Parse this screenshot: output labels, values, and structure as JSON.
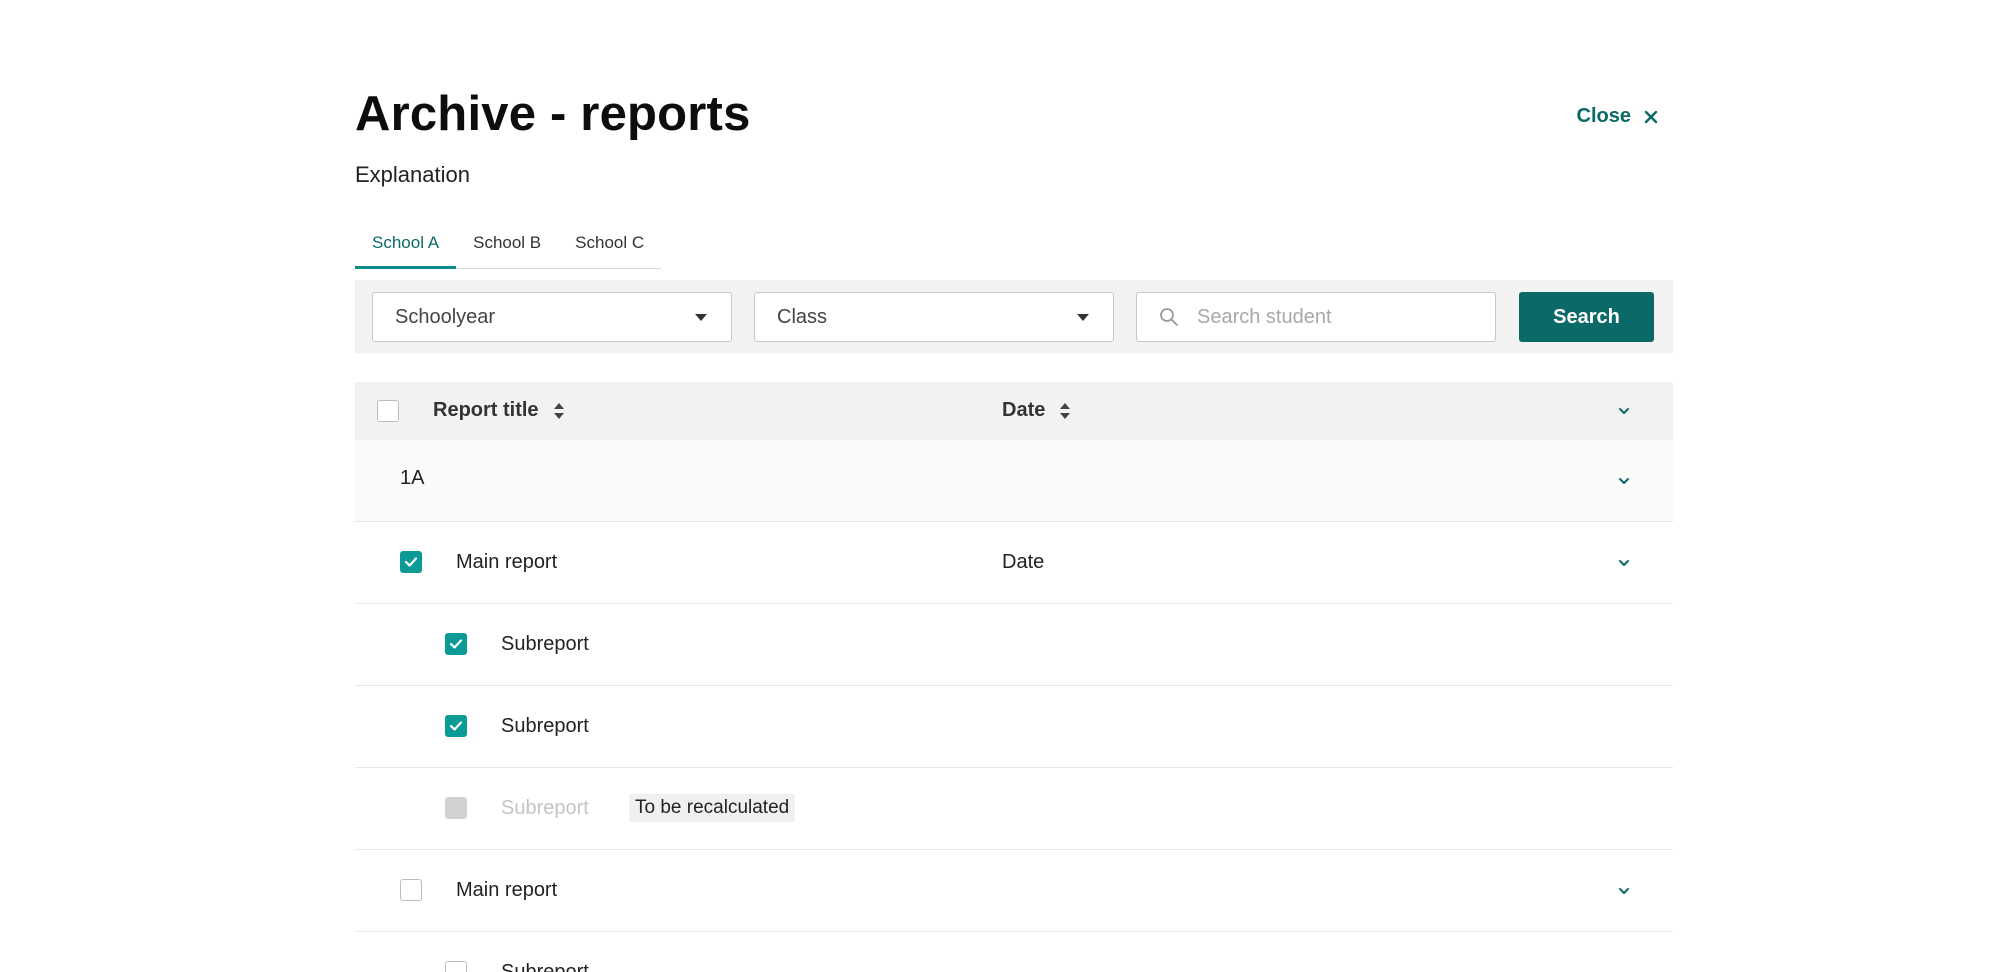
{
  "page": {
    "title": "Archive - reports",
    "subtitle": "Explanation",
    "close_label": "Close"
  },
  "tabs": [
    {
      "label": "School A",
      "active": true
    },
    {
      "label": "School B",
      "active": false
    },
    {
      "label": "School C",
      "active": false
    }
  ],
  "filters": {
    "schoolyear_label": "Schoolyear",
    "class_label": "Class",
    "search_placeholder": "Search student",
    "search_button": "Search"
  },
  "table": {
    "columns": {
      "title": "Report title",
      "date": "Date"
    },
    "group": {
      "label": "1A"
    },
    "rows": [
      {
        "title": "Main report",
        "date": "Date"
      },
      {
        "title": "Subreport"
      },
      {
        "title": "Subreport"
      },
      {
        "title": "Subreport",
        "tag": "To be recalculated"
      },
      {
        "title": "Main report"
      },
      {
        "title": "Subreport"
      }
    ]
  },
  "colors": {
    "accent": "#0b6a68",
    "checkbox": "#0b9a96",
    "tab_underline": "#0b8c88"
  }
}
